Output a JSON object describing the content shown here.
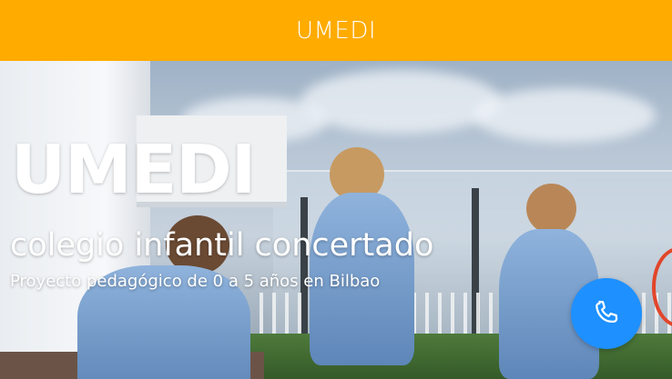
{
  "header": {
    "title": "UMEDI",
    "background_color": "#ffab00"
  },
  "hero": {
    "title": "UMEDI",
    "subtitle": "colegio infantil concertado",
    "tagline": "Proyecto pedagógico de 0 a 5 años en Bilbao"
  },
  "call_button": {
    "icon": "phone-icon",
    "color": "#1e90ff"
  }
}
